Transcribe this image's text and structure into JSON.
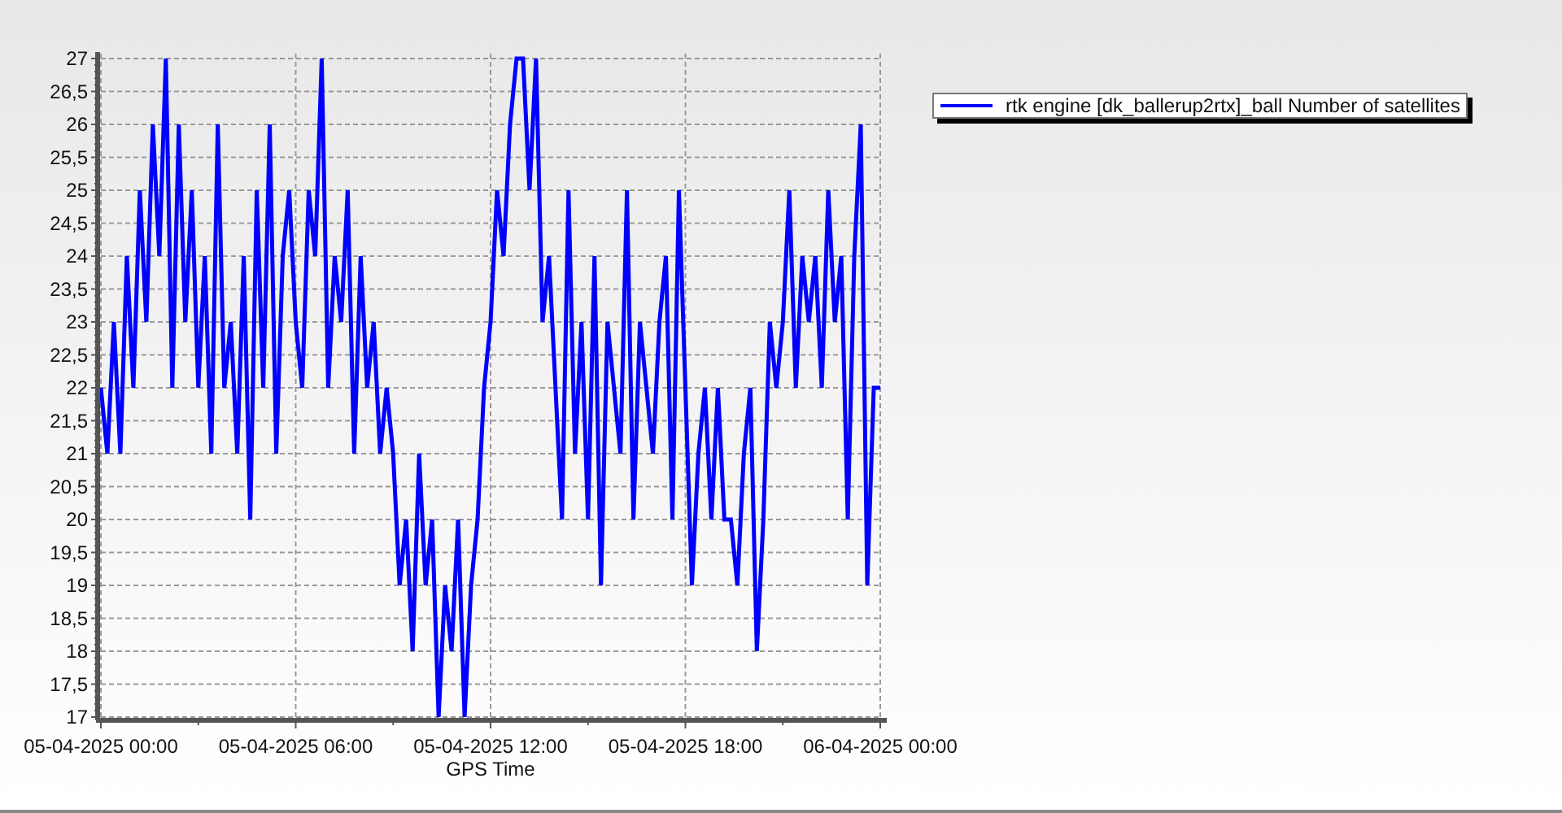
{
  "chart_data": {
    "type": "line",
    "grid": true,
    "xlabel": "GPS Time",
    "ylim": [
      17,
      27
    ],
    "categories": [
      "05-04-2025 00:00",
      null,
      null,
      null,
      null,
      null,
      null,
      null,
      null,
      null,
      null,
      null,
      null,
      null,
      null,
      null,
      null,
      null,
      null,
      null,
      null,
      null,
      null,
      null,
      null,
      null,
      null,
      null,
      null,
      null,
      "05-04-2025 06:00",
      null,
      null,
      null,
      null,
      null,
      null,
      null,
      null,
      null,
      null,
      null,
      null,
      null,
      null,
      null,
      null,
      null,
      null,
      null,
      null,
      null,
      null,
      null,
      null,
      null,
      null,
      null,
      null,
      null,
      "05-04-2025 12:00",
      null,
      null,
      null,
      null,
      null,
      null,
      null,
      null,
      null,
      null,
      null,
      null,
      null,
      null,
      null,
      null,
      null,
      null,
      null,
      null,
      null,
      null,
      null,
      null,
      null,
      null,
      null,
      null,
      null,
      "05-04-2025 18:00",
      null,
      null,
      null,
      null,
      null,
      null,
      null,
      null,
      null,
      null,
      null,
      null,
      null,
      null,
      null,
      null,
      null,
      null,
      null,
      null,
      null,
      null,
      null,
      null,
      null,
      null,
      null,
      null,
      null,
      "06-04-2025 00:00"
    ],
    "yticks": [
      {
        "value": 17,
        "label": "17"
      },
      {
        "value": 17.5,
        "label": "17,5"
      },
      {
        "value": 18,
        "label": "18"
      },
      {
        "value": 18.5,
        "label": "18,5"
      },
      {
        "value": 19,
        "label": "19"
      },
      {
        "value": 19.5,
        "label": "19,5"
      },
      {
        "value": 20,
        "label": "20"
      },
      {
        "value": 20.5,
        "label": "20,5"
      },
      {
        "value": 21,
        "label": "21"
      },
      {
        "value": 21.5,
        "label": "21,5"
      },
      {
        "value": 22,
        "label": "22"
      },
      {
        "value": 22.5,
        "label": "22,5"
      },
      {
        "value": 23,
        "label": "23"
      },
      {
        "value": 23.5,
        "label": "23,5"
      },
      {
        "value": 24,
        "label": "24"
      },
      {
        "value": 24.5,
        "label": "24,5"
      },
      {
        "value": 25,
        "label": "25"
      },
      {
        "value": 25.5,
        "label": "25,5"
      },
      {
        "value": 26,
        "label": "26"
      },
      {
        "value": 26.5,
        "label": "26,5"
      },
      {
        "value": 27,
        "label": "27"
      }
    ],
    "series": [
      {
        "name": "rtk engine [dk_ballerup2rtx]_ball Number of satellites",
        "color": "#0000ff",
        "values": [
          22,
          21,
          23,
          21,
          24,
          22,
          25,
          23,
          26,
          24,
          27,
          22,
          26,
          23,
          25,
          22,
          24,
          21,
          26,
          22,
          23,
          21,
          24,
          20,
          25,
          22,
          26,
          21,
          24,
          25,
          23,
          22,
          25,
          24,
          27,
          22,
          24,
          23,
          25,
          21,
          24,
          22,
          23,
          21,
          22,
          21,
          19,
          20,
          18,
          21,
          19,
          20,
          17,
          19,
          18,
          20,
          17,
          19,
          20,
          22,
          23,
          25,
          24,
          26,
          27,
          27,
          25,
          27,
          23,
          24,
          22,
          20,
          25,
          21,
          23,
          20,
          24,
          19,
          23,
          22,
          21,
          25,
          20,
          23,
          22,
          21,
          23,
          24,
          20,
          25,
          22,
          19,
          21,
          22,
          20,
          22,
          20,
          20,
          19,
          21,
          22,
          18,
          20,
          23,
          22,
          23,
          25,
          22,
          24,
          23,
          24,
          22,
          25,
          23,
          24,
          20,
          24,
          26,
          19,
          22,
          22
        ]
      }
    ]
  }
}
